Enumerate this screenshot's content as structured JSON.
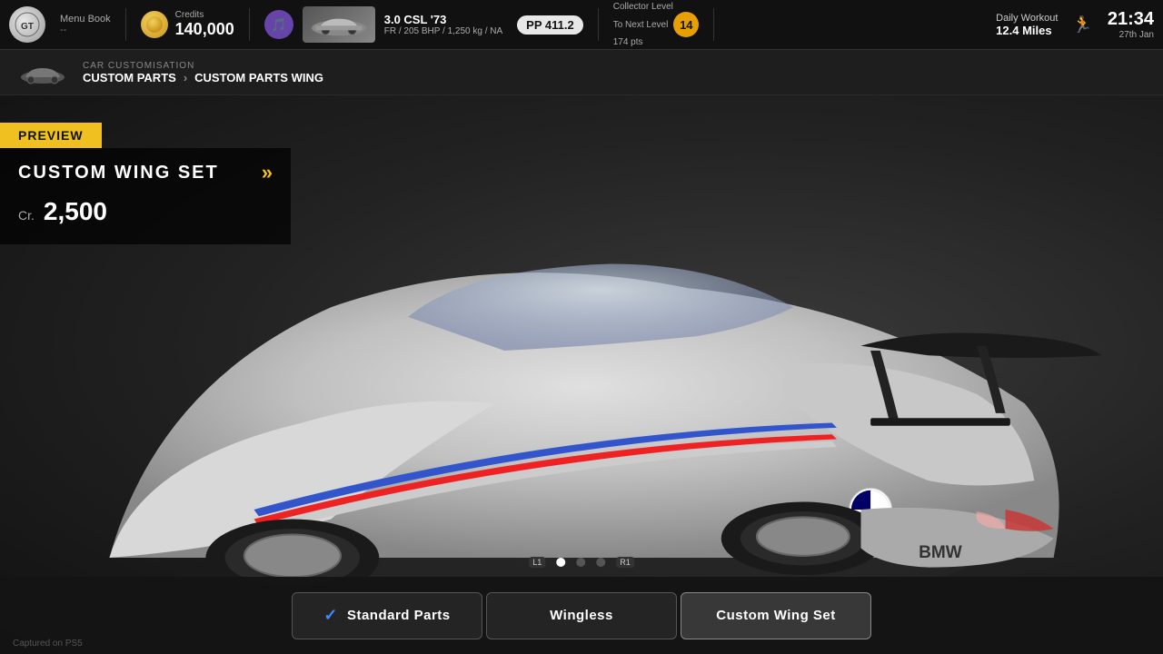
{
  "header": {
    "logo_text": "GT",
    "menu_book_title": "Menu Book",
    "menu_book_sub": "--",
    "credits_label": "Credits",
    "credits_value": "140,000",
    "car_name": "3.0 CSL '73",
    "car_specs": "FR / 205 BHP / 1,250 kg / NA",
    "pp_badge": "PP 411.2",
    "collector_label": "Collector Level",
    "collector_next": "To Next Level",
    "collector_pts": "174 pts",
    "collector_level": "14",
    "daily_workout_title": "Daily Workout",
    "daily_workout_miles": "12.4 Miles",
    "time_value": "21:34",
    "date_value": "27th Jan"
  },
  "breadcrumb": {
    "customisation_label": "CAR CUSTOMISATION",
    "section1": "CUSTOM PARTS",
    "section2": "CUSTOM PARTS WING"
  },
  "preview": {
    "badge_label": "PREVIEW",
    "wing_set_title": "CUSTOM WING SET",
    "cr_label": "Cr.",
    "price": "2,500"
  },
  "dots": {
    "active_index": 0,
    "total": 3
  },
  "buttons": {
    "standard_parts": "Standard Parts",
    "wingless": "Wingless",
    "custom_wing_set": "Custom Wing Set"
  },
  "footer": {
    "captured_label": "Captured on PS5"
  }
}
